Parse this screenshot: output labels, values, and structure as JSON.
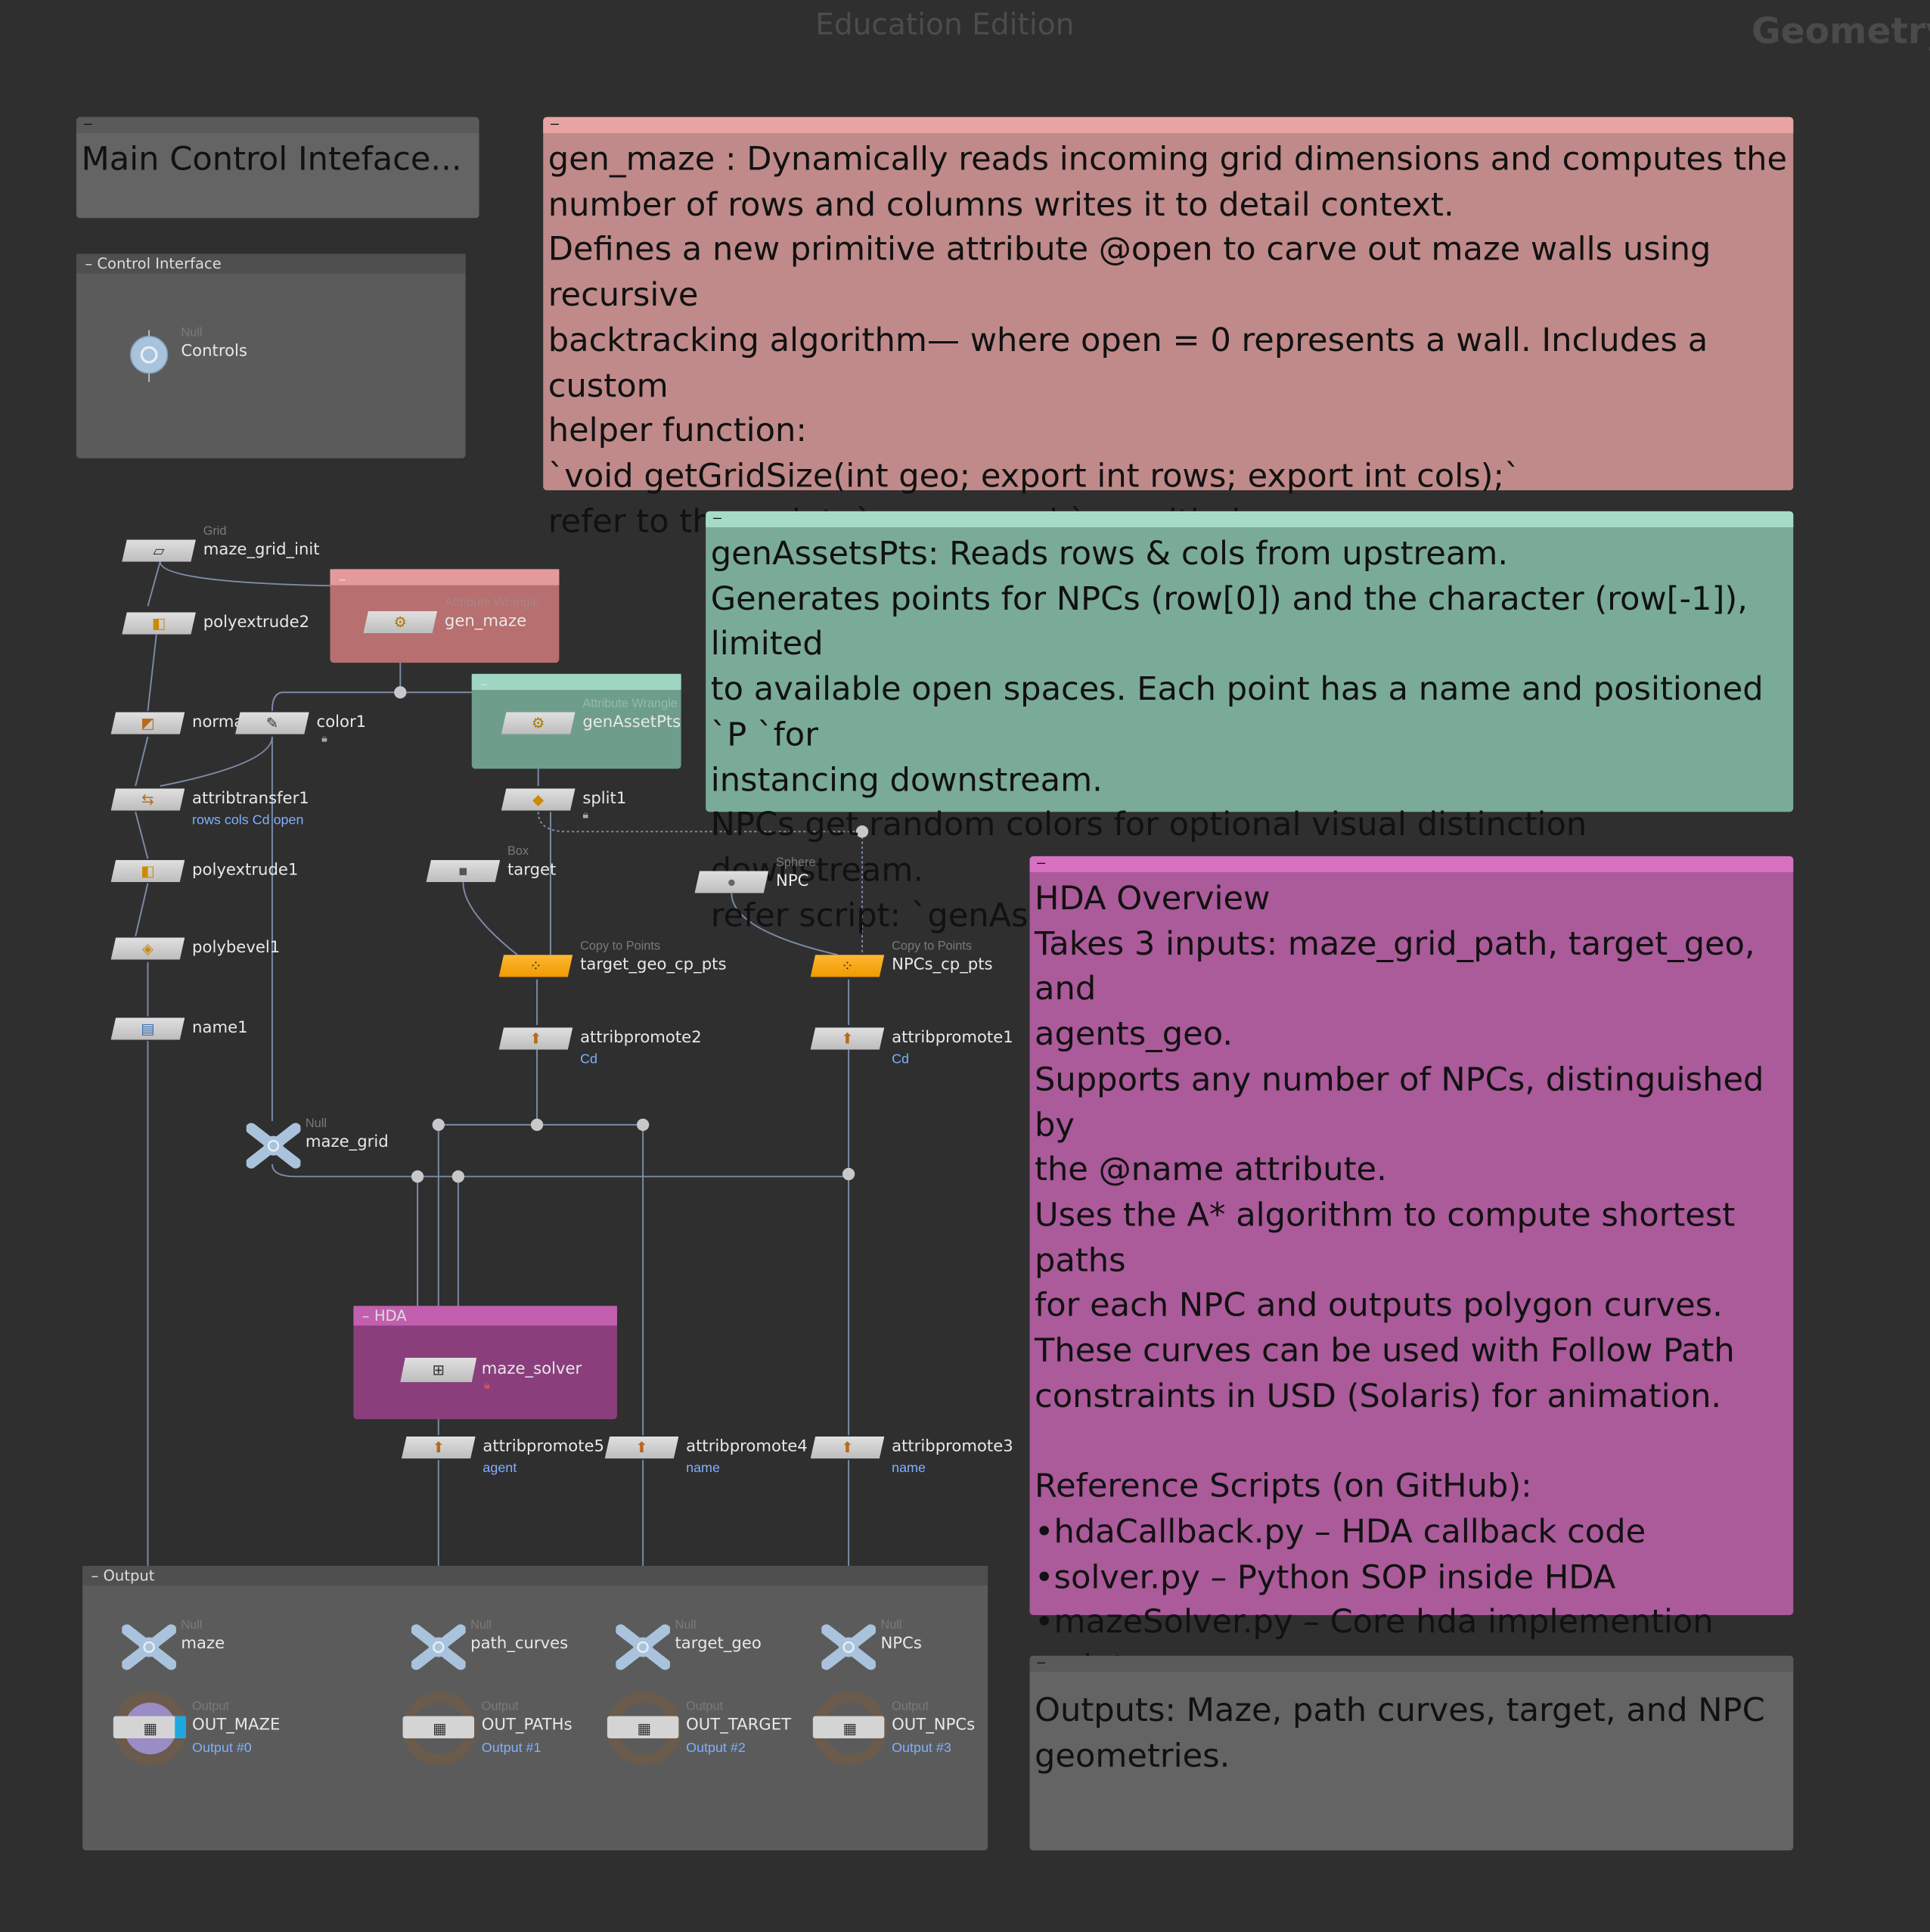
{
  "watermark": "Education Edition",
  "context_label": "Geometry",
  "colors": {
    "background": "#2f2f2f",
    "sticky_red": "#c08a8a",
    "sticky_green": "#7aab98",
    "sticky_magenta": "#ab5a9a",
    "sticky_gray": "#646464",
    "copy_node_orange": "#f5a623",
    "param_blue": "#7fb0ff"
  },
  "sticky_main": {
    "text": "Main Control Inteface..."
  },
  "sticky_gen_maze": {
    "text": "gen_maze : Dynamically reads incoming grid dimensions and computes the\nnumber of rows and columns writes it to detail context.\nDefines a new primitive attribute @open to carve out maze walls using recursive\nbacktracking algorithm— where open = 0 represents a wall. Includes a custom\nhelper function:\n`void getGridSize(int geo; export int rows; export int cols);`\nrefer to the script: `gen_maze.h` on github repo"
  },
  "sticky_gen_assets": {
    "text": "genAssetsPts: Reads rows & cols from upstream.\nGenerates points for NPCs (row[0]) and the character (row[-1]), limited\nto available open spaces. Each point has a name and positioned `P `for\ninstancing downstream.\nNPCs get random colors for optional visual distinction downstream.\nrefer script: `genAssetpts.h` on github repo"
  },
  "sticky_hda": {
    "text": "HDA Overview\nTakes 3 inputs: maze_grid_path, target_geo, and\nagents_geo.\nSupports any number of NPCs, distinguished by\nthe @name attribute.\nUses the A* algorithm to compute shortest paths\nfor each NPC and outputs polygon curves.\nThese curves can be used with Follow Path\nconstraints in USD (Solaris) for animation.\n\nReference Scripts (on GitHub):\n•hdaCallback.py – HDA callback code\n•solver.py – Python SOP inside HDA\n•mazeSolver.py – Core hda implemention script"
  },
  "sticky_outputs": {
    "text": "Outputs: Maze, path curves, target, and NPC\ngeometries."
  },
  "boxes": {
    "control": "Control Interface",
    "gen_maze": "",
    "gen_assets": "",
    "hda": "HDA",
    "output": "Output"
  },
  "nodes": {
    "controls": {
      "type": "Null",
      "name": "Controls",
      "icon": "null-icon"
    },
    "maze_grid_init": {
      "type": "Grid",
      "name": "maze_grid_init",
      "icon": "grid-icon"
    },
    "polyextrude2": {
      "name": "polyextrude2",
      "icon": "polyextrude-icon"
    },
    "gen_maze": {
      "type": "Attribute Wrangle",
      "name": "gen_maze",
      "icon": "wrangle-icon"
    },
    "normal": {
      "name": "norma",
      "icon": "normal-icon"
    },
    "color1": {
      "name": "color1",
      "icon": "color-icon"
    },
    "genAssetPts": {
      "type": "Attribute Wrangle",
      "name": "genAssetPts",
      "icon": "wrangle-icon"
    },
    "attribtransfer1": {
      "name": "attribtransfer1",
      "sub": "rows cols Cd open",
      "icon": "attribtransfer-icon"
    },
    "split1": {
      "name": "split1",
      "icon": "split-icon"
    },
    "polyextrude1": {
      "name": "polyextrude1",
      "icon": "polyextrude-icon"
    },
    "target": {
      "type": "Box",
      "name": "target",
      "icon": "box-icon"
    },
    "npc": {
      "type": "Sphere",
      "name": "NPC",
      "icon": "sphere-icon"
    },
    "polybevel1": {
      "name": "polybevel1",
      "icon": "polybevel-icon"
    },
    "target_geo_cp_pts": {
      "type": "Copy to Points",
      "name": "target_geo_cp_pts",
      "icon": "copy-to-points-icon"
    },
    "npcs_cp_pts": {
      "type": "Copy to Points",
      "name": "NPCs_cp_pts",
      "icon": "copy-to-points-icon"
    },
    "name1": {
      "name": "name1",
      "icon": "name-icon"
    },
    "attribpromote2": {
      "name": "attribpromote2",
      "sub": "Cd",
      "icon": "attribpromote-icon"
    },
    "attribpromote1": {
      "name": "attribpromote1",
      "sub": "Cd",
      "icon": "attribpromote-icon"
    },
    "maze_grid": {
      "type": "Null",
      "name": "maze_grid",
      "icon": "null-icon"
    },
    "maze_solver": {
      "name": "maze_solver",
      "icon": "hda-icon"
    },
    "attribpromote5": {
      "name": "attribpromote5",
      "sub": "agent",
      "icon": "attribpromote-icon"
    },
    "attribpromote4": {
      "name": "attribpromote4",
      "sub": "name",
      "icon": "attribpromote-icon"
    },
    "attribpromote3": {
      "name": "attribpromote3",
      "sub": "name",
      "icon": "attribpromote-icon"
    },
    "null_maze": {
      "type": "Null",
      "name": "maze",
      "icon": "null-icon"
    },
    "null_path_curves": {
      "type": "Null",
      "name": "path_curves",
      "icon": "null-icon"
    },
    "null_target_geo": {
      "type": "Null",
      "name": "target_geo",
      "icon": "null-icon"
    },
    "null_npcs": {
      "type": "Null",
      "name": "NPCs",
      "icon": "null-icon"
    },
    "out_maze": {
      "type": "Output",
      "name": "OUT_MAZE",
      "sub": "Output #0",
      "icon": "output-icon"
    },
    "out_paths": {
      "type": "Output",
      "name": "OUT_PATHs",
      "sub": "Output #1",
      "icon": "output-icon"
    },
    "out_target": {
      "type": "Output",
      "name": "OUT_TARGET",
      "sub": "Output #2",
      "icon": "output-icon"
    },
    "out_npcs": {
      "type": "Output",
      "name": "OUT_NPCs",
      "sub": "Output #3",
      "icon": "output-icon"
    }
  }
}
